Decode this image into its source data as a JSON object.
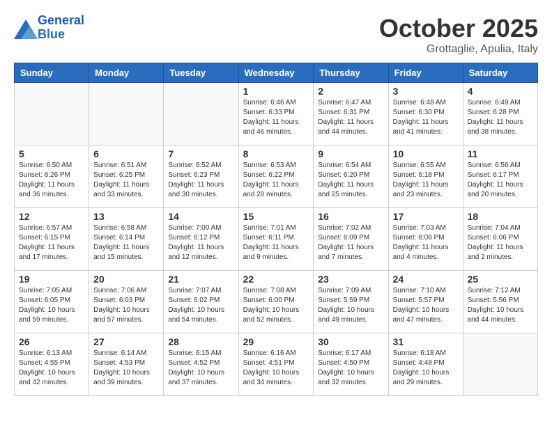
{
  "header": {
    "logo": {
      "line1": "General",
      "line2": "Blue"
    },
    "title": "October 2025",
    "location": "Grottaglie, Apulia, Italy"
  },
  "weekdays": [
    "Sunday",
    "Monday",
    "Tuesday",
    "Wednesday",
    "Thursday",
    "Friday",
    "Saturday"
  ],
  "weeks": [
    [
      {
        "day": "",
        "info": ""
      },
      {
        "day": "",
        "info": ""
      },
      {
        "day": "",
        "info": ""
      },
      {
        "day": "1",
        "info": "Sunrise: 6:46 AM\nSunset: 6:33 PM\nDaylight: 11 hours\nand 46 minutes."
      },
      {
        "day": "2",
        "info": "Sunrise: 6:47 AM\nSunset: 6:31 PM\nDaylight: 11 hours\nand 44 minutes."
      },
      {
        "day": "3",
        "info": "Sunrise: 6:48 AM\nSunset: 6:30 PM\nDaylight: 11 hours\nand 41 minutes."
      },
      {
        "day": "4",
        "info": "Sunrise: 6:49 AM\nSunset: 6:28 PM\nDaylight: 11 hours\nand 38 minutes."
      }
    ],
    [
      {
        "day": "5",
        "info": "Sunrise: 6:50 AM\nSunset: 6:26 PM\nDaylight: 11 hours\nand 36 minutes."
      },
      {
        "day": "6",
        "info": "Sunrise: 6:51 AM\nSunset: 6:25 PM\nDaylight: 11 hours\nand 33 minutes."
      },
      {
        "day": "7",
        "info": "Sunrise: 6:52 AM\nSunset: 6:23 PM\nDaylight: 11 hours\nand 30 minutes."
      },
      {
        "day": "8",
        "info": "Sunrise: 6:53 AM\nSunset: 6:22 PM\nDaylight: 11 hours\nand 28 minutes."
      },
      {
        "day": "9",
        "info": "Sunrise: 6:54 AM\nSunset: 6:20 PM\nDaylight: 11 hours\nand 25 minutes."
      },
      {
        "day": "10",
        "info": "Sunrise: 6:55 AM\nSunset: 6:18 PM\nDaylight: 11 hours\nand 23 minutes."
      },
      {
        "day": "11",
        "info": "Sunrise: 6:56 AM\nSunset: 6:17 PM\nDaylight: 11 hours\nand 20 minutes."
      }
    ],
    [
      {
        "day": "12",
        "info": "Sunrise: 6:57 AM\nSunset: 6:15 PM\nDaylight: 11 hours\nand 17 minutes."
      },
      {
        "day": "13",
        "info": "Sunrise: 6:58 AM\nSunset: 6:14 PM\nDaylight: 11 hours\nand 15 minutes."
      },
      {
        "day": "14",
        "info": "Sunrise: 7:00 AM\nSunset: 6:12 PM\nDaylight: 11 hours\nand 12 minutes."
      },
      {
        "day": "15",
        "info": "Sunrise: 7:01 AM\nSunset: 6:11 PM\nDaylight: 11 hours\nand 9 minutes."
      },
      {
        "day": "16",
        "info": "Sunrise: 7:02 AM\nSunset: 6:09 PM\nDaylight: 11 hours\nand 7 minutes."
      },
      {
        "day": "17",
        "info": "Sunrise: 7:03 AM\nSunset: 6:08 PM\nDaylight: 11 hours\nand 4 minutes."
      },
      {
        "day": "18",
        "info": "Sunrise: 7:04 AM\nSunset: 6:06 PM\nDaylight: 11 hours\nand 2 minutes."
      }
    ],
    [
      {
        "day": "19",
        "info": "Sunrise: 7:05 AM\nSunset: 6:05 PM\nDaylight: 10 hours\nand 59 minutes."
      },
      {
        "day": "20",
        "info": "Sunrise: 7:06 AM\nSunset: 6:03 PM\nDaylight: 10 hours\nand 57 minutes."
      },
      {
        "day": "21",
        "info": "Sunrise: 7:07 AM\nSunset: 6:02 PM\nDaylight: 10 hours\nand 54 minutes."
      },
      {
        "day": "22",
        "info": "Sunrise: 7:08 AM\nSunset: 6:00 PM\nDaylight: 10 hours\nand 52 minutes."
      },
      {
        "day": "23",
        "info": "Sunrise: 7:09 AM\nSunset: 5:59 PM\nDaylight: 10 hours\nand 49 minutes."
      },
      {
        "day": "24",
        "info": "Sunrise: 7:10 AM\nSunset: 5:57 PM\nDaylight: 10 hours\nand 47 minutes."
      },
      {
        "day": "25",
        "info": "Sunrise: 7:12 AM\nSunset: 5:56 PM\nDaylight: 10 hours\nand 44 minutes."
      }
    ],
    [
      {
        "day": "26",
        "info": "Sunrise: 6:13 AM\nSunset: 4:55 PM\nDaylight: 10 hours\nand 42 minutes."
      },
      {
        "day": "27",
        "info": "Sunrise: 6:14 AM\nSunset: 4:53 PM\nDaylight: 10 hours\nand 39 minutes."
      },
      {
        "day": "28",
        "info": "Sunrise: 6:15 AM\nSunset: 4:52 PM\nDaylight: 10 hours\nand 37 minutes."
      },
      {
        "day": "29",
        "info": "Sunrise: 6:16 AM\nSunset: 4:51 PM\nDaylight: 10 hours\nand 34 minutes."
      },
      {
        "day": "30",
        "info": "Sunrise: 6:17 AM\nSunset: 4:50 PM\nDaylight: 10 hours\nand 32 minutes."
      },
      {
        "day": "31",
        "info": "Sunrise: 6:18 AM\nSunset: 4:48 PM\nDaylight: 10 hours\nand 29 minutes."
      },
      {
        "day": "",
        "info": ""
      }
    ]
  ]
}
